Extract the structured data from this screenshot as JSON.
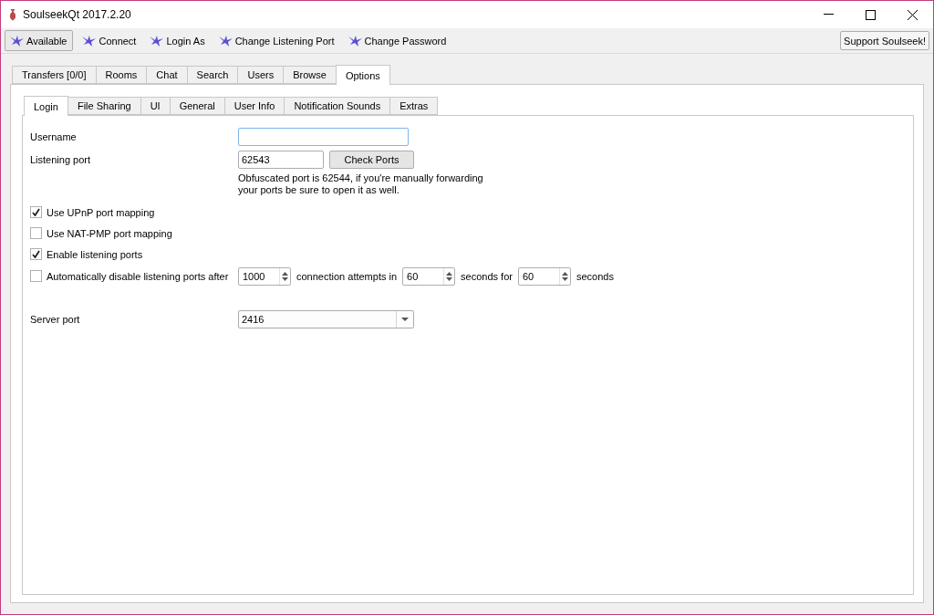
{
  "window": {
    "title": "SoulseekQt 2017.2.20"
  },
  "toolbar": {
    "status_button": "Available",
    "actions": [
      "Connect",
      "Login As",
      "Change Listening Port",
      "Change Password"
    ],
    "support_button": "Support Soulseek!"
  },
  "tabs": [
    {
      "label": "Transfers [0/0]",
      "selected": false
    },
    {
      "label": "Rooms",
      "selected": false
    },
    {
      "label": "Chat",
      "selected": false
    },
    {
      "label": "Search",
      "selected": false
    },
    {
      "label": "Users",
      "selected": false
    },
    {
      "label": "Browse",
      "selected": false
    },
    {
      "label": "Options",
      "selected": true
    }
  ],
  "subtabs": [
    {
      "label": "Login",
      "selected": true
    },
    {
      "label": "File Sharing",
      "selected": false
    },
    {
      "label": "UI",
      "selected": false
    },
    {
      "label": "General",
      "selected": false
    },
    {
      "label": "User Info",
      "selected": false
    },
    {
      "label": "Notification Sounds",
      "selected": false
    },
    {
      "label": "Extras",
      "selected": false
    }
  ],
  "login": {
    "username_label": "Username",
    "listening_port_label": "Listening port",
    "listening_port_value": "62543",
    "check_ports_button": "Check Ports",
    "note": "Obfuscated port is 62544, if you're manually forwarding\nyour ports be sure to open it as well.",
    "checkboxes": [
      {
        "label": "Use UPnP port mapping",
        "checked": true
      },
      {
        "label": "Use NAT-PMP port mapping",
        "checked": false
      },
      {
        "label": "Enable listening ports",
        "checked": true
      }
    ],
    "auto_disable": {
      "label": "Automatically disable listening ports after",
      "checked": false,
      "attempts": "1000",
      "attempts_label": "connection attempts in",
      "seconds": "60",
      "seconds_for_label": "seconds for",
      "duration": "60",
      "seconds_label": "seconds"
    },
    "server_port_label": "Server port",
    "server_port_value": "2416"
  }
}
